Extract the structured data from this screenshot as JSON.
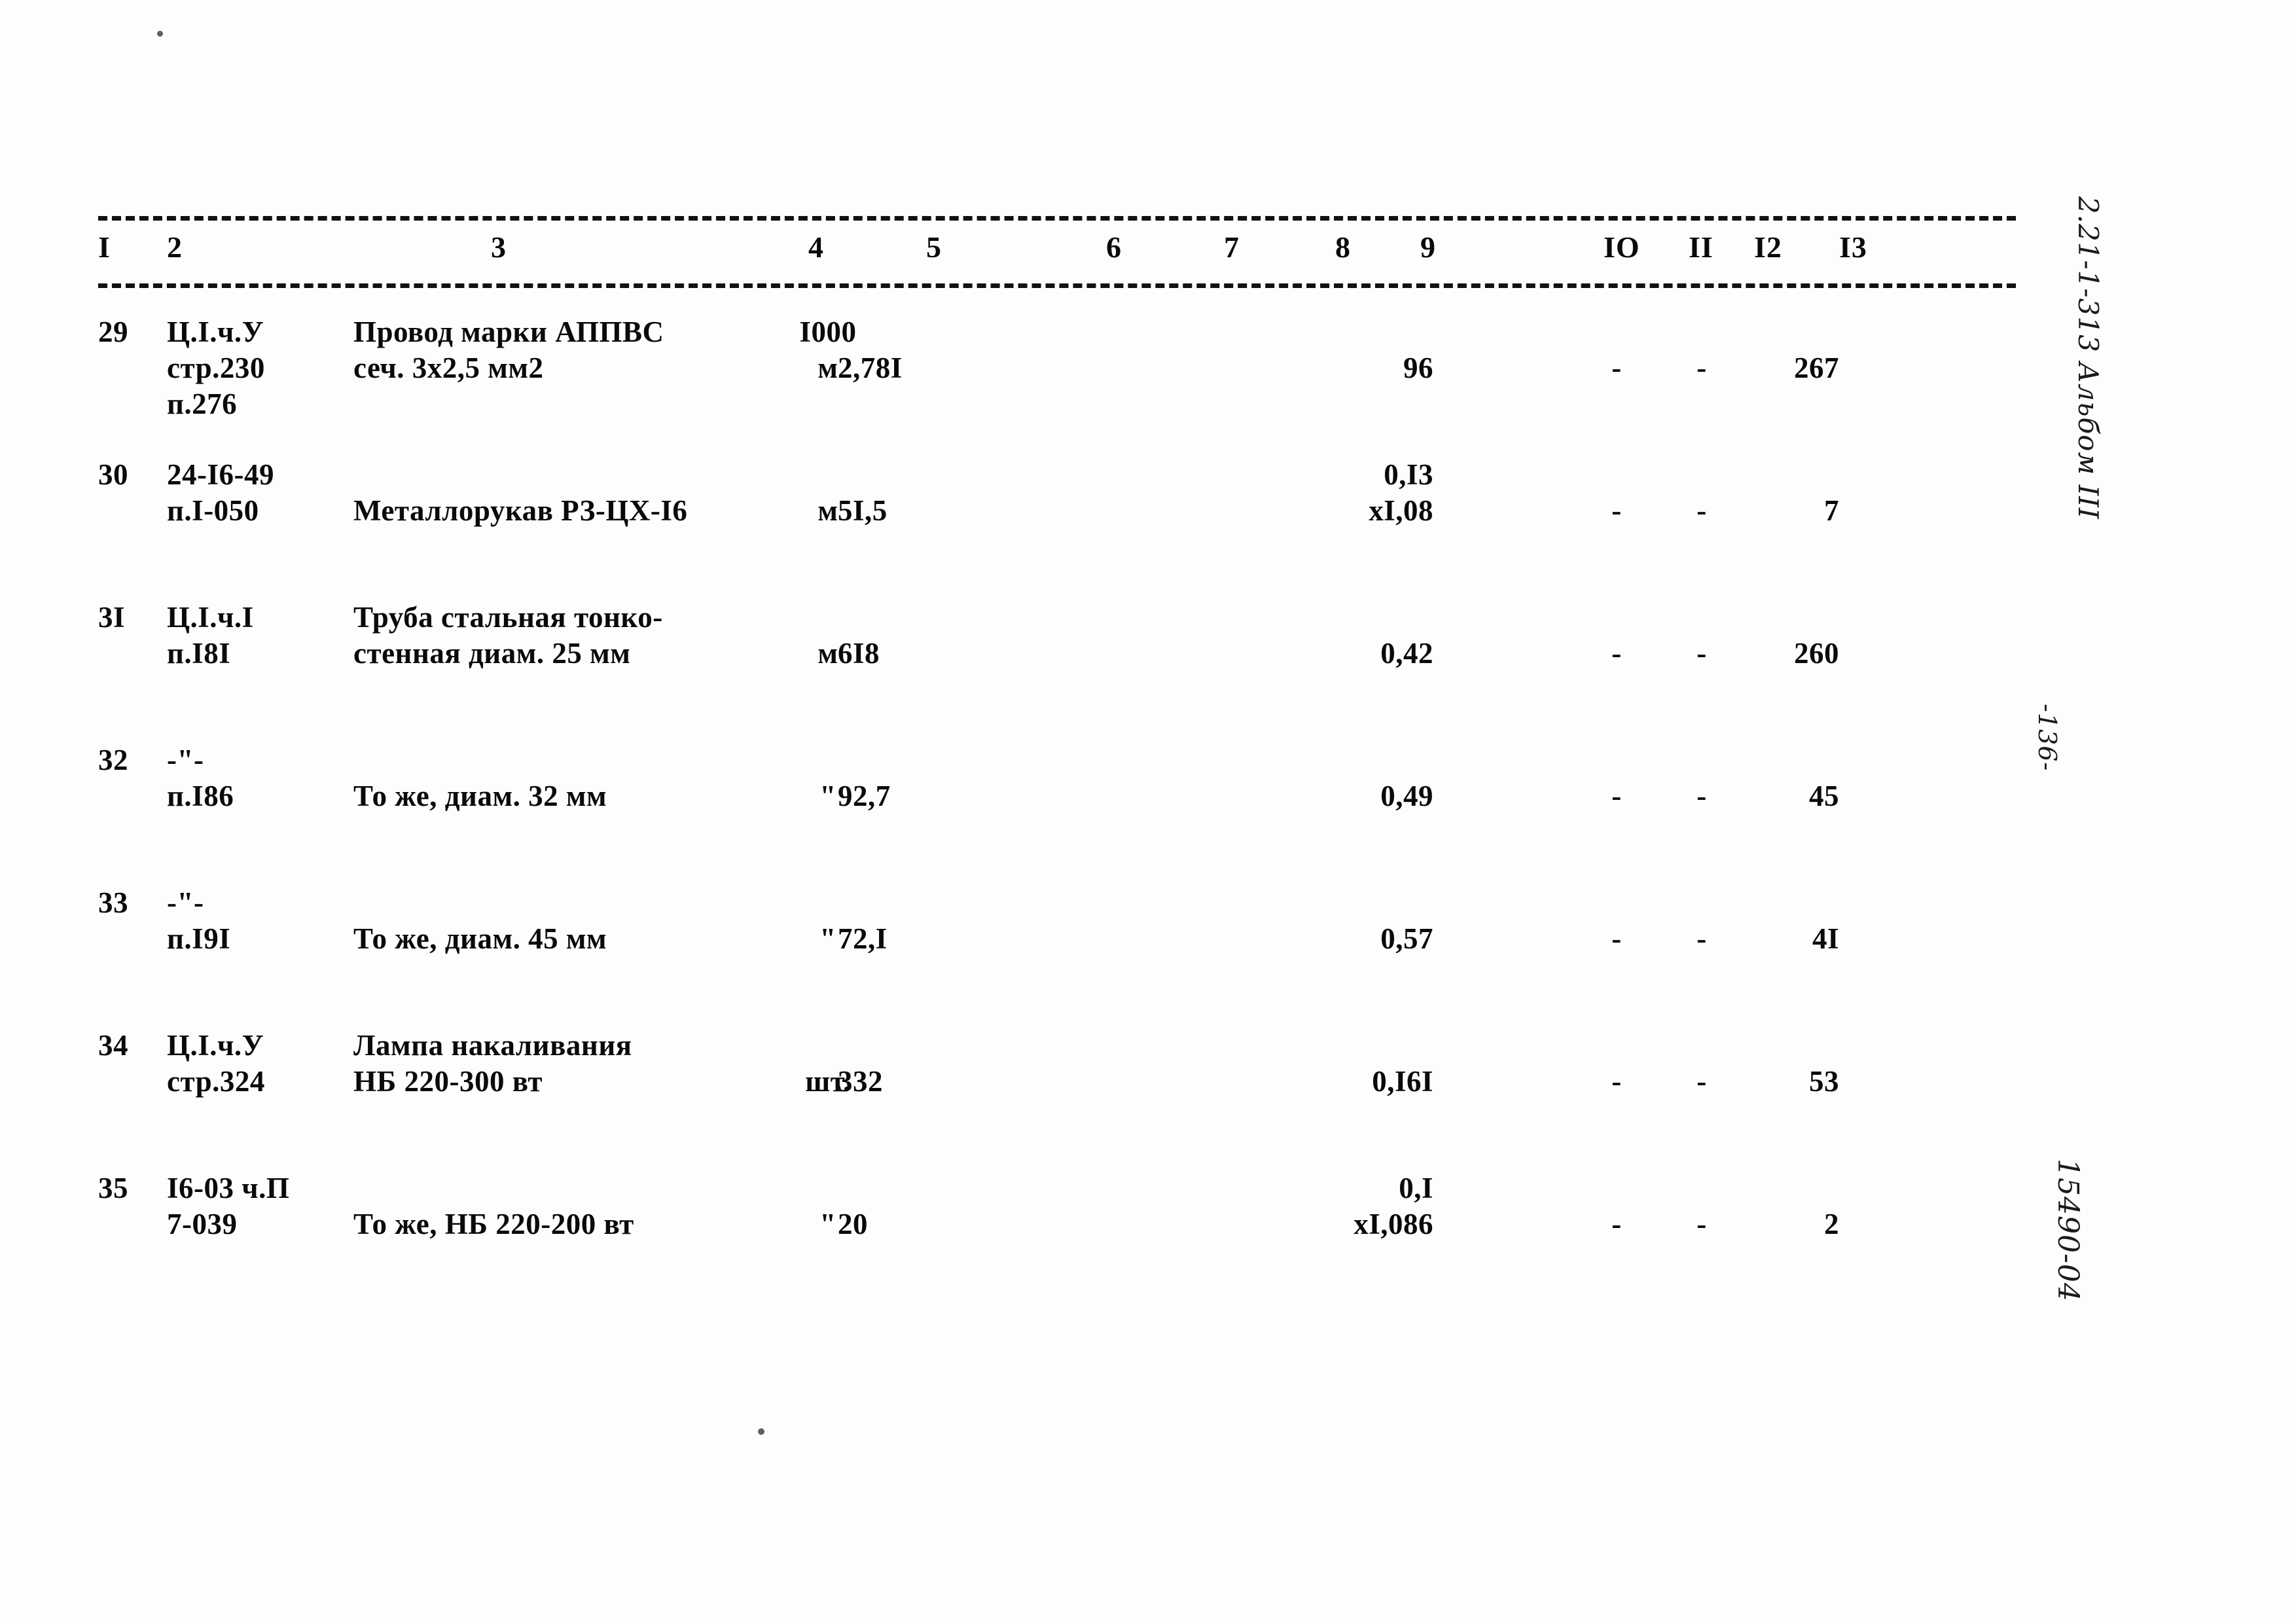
{
  "document": {
    "type": "estimate-table",
    "header_labels": [
      "I",
      "2",
      "3",
      "4",
      "5",
      "6",
      "7",
      "8",
      "9",
      "IO",
      "II",
      "I2",
      "I3"
    ]
  },
  "margin_notes": {
    "album": "2.21-1-313 Альбом III",
    "page": "-136-",
    "archive": "15490-04"
  },
  "rows": [
    {
      "num": "29",
      "code_l0": "Ц.I.ч.У",
      "code_l1": "стр.230",
      "code_l2": "п.276",
      "name_l0": "Провод марки АППВС",
      "name_l1": "сеч. 3х2,5 мм2",
      "unit_l0": "I000",
      "unit_l1": "м",
      "qty": "2,78I",
      "col9_l0": "",
      "col9_l1": "96",
      "col10": "-",
      "col11": "-",
      "col12": "267"
    },
    {
      "num": "30",
      "code_l0": "24-I6-49",
      "code_l1": "п.I-050",
      "code_l2": "",
      "name_l0": "",
      "name_l1": "Металлорукав РЗ-ЦХ-I6",
      "unit_l0": "",
      "unit_l1": "м",
      "qty": "5I,5",
      "col9_l0": "0,I3",
      "col9_l1": "xI,08",
      "col10": "-",
      "col11": "-",
      "col12": "7"
    },
    {
      "num": "3I",
      "code_l0": "Ц.I.ч.I",
      "code_l1": "п.I8I",
      "code_l2": "",
      "name_l0": "Труба стальная тонко-",
      "name_l1": "стенная диам. 25 мм",
      "unit_l0": "",
      "unit_l1": "м",
      "qty": "6I8",
      "col9_l0": "",
      "col9_l1": "0,42",
      "col10": "-",
      "col11": "-",
      "col12": "260"
    },
    {
      "num": "32",
      "code_l0": "-\"-",
      "code_l1": "п.I86",
      "code_l2": "",
      "name_l0": "",
      "name_l1": "То же, диам. 32 мм",
      "unit_l0": "",
      "unit_l1": "\"",
      "qty": "92,7",
      "col9_l0": "",
      "col9_l1": "0,49",
      "col10": "-",
      "col11": "-",
      "col12": "45"
    },
    {
      "num": "33",
      "code_l0": "-\"-",
      "code_l1": "п.I9I",
      "code_l2": "",
      "name_l0": "",
      "name_l1": "То же, диам. 45 мм",
      "unit_l0": "",
      "unit_l1": "\"",
      "qty": "72,I",
      "col9_l0": "",
      "col9_l1": "0,57",
      "col10": "-",
      "col11": "-",
      "col12": "4I"
    },
    {
      "num": "34",
      "code_l0": "Ц.I.ч.У",
      "code_l1": "стр.324",
      "code_l2": "",
      "name_l0": "Лампа накаливания",
      "name_l1": "НБ 220-300 вт",
      "unit_l0": "",
      "unit_l1": "шт.",
      "qty": "332",
      "col9_l0": "",
      "col9_l1": "0,I6I",
      "col10": "-",
      "col11": "-",
      "col12": "53"
    },
    {
      "num": "35",
      "code_l0": "I6-03 ч.П",
      "code_l1": "7-039",
      "code_l2": "",
      "name_l0": "",
      "name_l1": "То же, НБ 220-200 вт",
      "unit_l0": "",
      "unit_l1": "\"",
      "qty": "20",
      "col9_l0": "0,I",
      "col9_l1": "xI,086",
      "col10": "-",
      "col11": "-",
      "col12": "2"
    }
  ]
}
